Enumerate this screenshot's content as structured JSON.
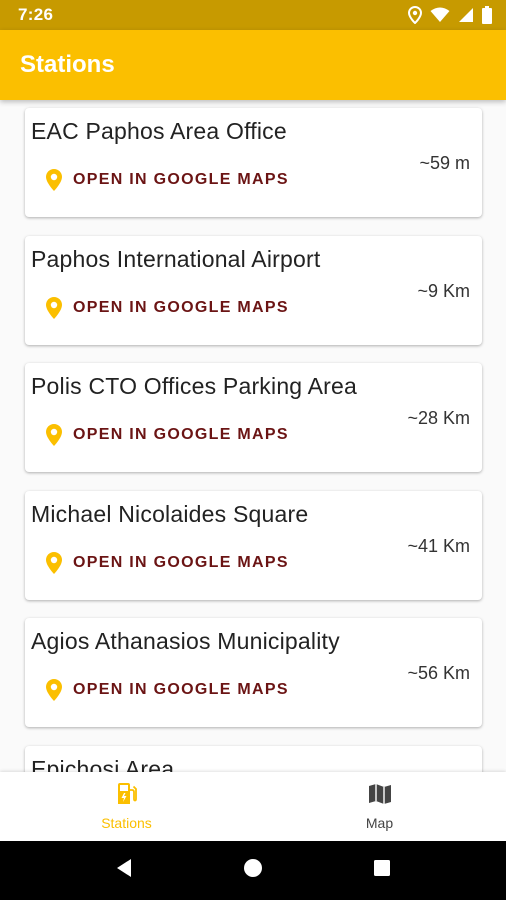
{
  "status_bar": {
    "time": "7:26",
    "icons": [
      "location-icon",
      "wifi-icon",
      "signal-icon",
      "battery-icon"
    ]
  },
  "app_bar": {
    "title": "Stations"
  },
  "stations": [
    {
      "name": "EAC Paphos Area Office",
      "distance": "~59 m",
      "action": "OPEN IN GOOGLE MAPS"
    },
    {
      "name": "Paphos International Airport",
      "distance": "~9 Km",
      "action": "OPEN IN GOOGLE MAPS"
    },
    {
      "name": "Polis CTO Offices Parking Area",
      "distance": "~28 Km",
      "action": "OPEN IN GOOGLE MAPS"
    },
    {
      "name": "Michael Nicolaides Square",
      "distance": "~41 Km",
      "action": "OPEN IN GOOGLE MAPS"
    },
    {
      "name": "Agios Athanasios Municipality",
      "distance": "~56 Km",
      "action": "OPEN IN GOOGLE MAPS"
    },
    {
      "name": "Epichosi Area",
      "distance": "",
      "action": ""
    }
  ],
  "bottom_nav": {
    "items": [
      {
        "label": "Stations",
        "icon": "ev-station-icon",
        "active": true
      },
      {
        "label": "Map",
        "icon": "map-icon",
        "active": false
      }
    ]
  },
  "colors": {
    "status_bar": "#c79a00",
    "app_bar": "#fbbf00",
    "accent": "#fbbf00",
    "action_text": "#6b1414"
  }
}
